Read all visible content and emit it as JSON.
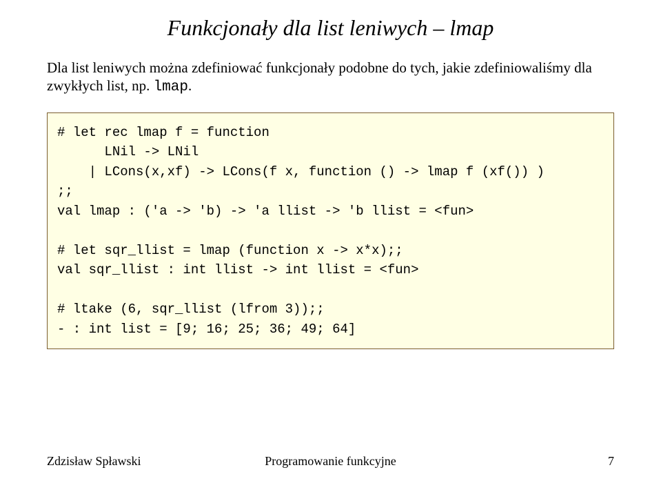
{
  "title": "Funkcjonały dla list leniwych – lmap",
  "intro_pre": "Dla list leniwych można zdefiniować funkcjonały podobne do tych, jakie zdefiniowaliśmy dla zwykłych list, np. ",
  "intro_code": "lmap",
  "intro_post": ".",
  "code": "# let rec lmap f = function\n      LNil -> LNil\n    | LCons(x,xf) -> LCons(f x, function () -> lmap f (xf()) )\n;;\nval lmap : ('a -> 'b) -> 'a llist -> 'b llist = <fun>\n\n# let sqr_llist = lmap (function x -> x*x);;\nval sqr_llist : int llist -> int llist = <fun>\n\n# ltake (6, sqr_llist (lfrom 3));;\n- : int list = [9; 16; 25; 36; 49; 64]",
  "footer": {
    "left": "Zdzisław Spławski",
    "center": "Programowanie funkcyjne",
    "right": "7"
  }
}
